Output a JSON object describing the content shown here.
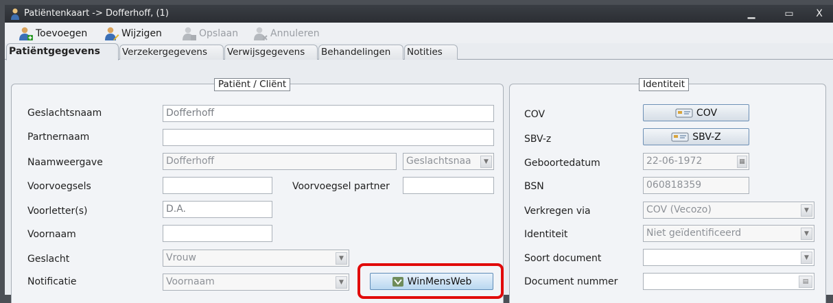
{
  "window": {
    "title": "Patiëntenkaart -> Dofferhoff, (1)",
    "controls": {
      "minimize": "▁",
      "maximize": "▭",
      "close": "X"
    }
  },
  "toolbar": {
    "add_label": "Toevoegen",
    "edit_label": "Wijzigen",
    "save_label": "Opslaan",
    "cancel_label": "Annuleren"
  },
  "tabs": [
    {
      "label": "Patiëntgegevens",
      "active": true
    },
    {
      "label": "Verzekergegevens"
    },
    {
      "label": "Verwijsgegevens"
    },
    {
      "label": "Behandelingen"
    },
    {
      "label": "Notities"
    }
  ],
  "patient": {
    "legend": "Patiënt / Cliënt",
    "geslachtsnaam": {
      "label": "Geslachtsnaam",
      "value": "Dofferhoff"
    },
    "partnernaam": {
      "label": "Partnernaam",
      "value": ""
    },
    "naamweergave": {
      "label": "Naamweergave",
      "value": "Dofferhoff",
      "option": "Geslachtsnaa"
    },
    "voorvoegsels": {
      "label": "Voorvoegsels",
      "value": ""
    },
    "voorvoegsel_partner": {
      "label": "Voorvoegsel partner",
      "value": ""
    },
    "voorletters": {
      "label": "Voorletter(s)",
      "value": "D.A."
    },
    "voornaam": {
      "label": "Voornaam",
      "value": ""
    },
    "geslacht": {
      "label": "Geslacht",
      "value": "Vrouw"
    },
    "notificatie": {
      "label": "Notificatie",
      "value": "Voornaam"
    },
    "winmensweb_label": "WinMensWeb"
  },
  "identiteit": {
    "legend": "Identiteit",
    "cov": {
      "label": "COV",
      "button": "COV"
    },
    "sbvz": {
      "label": "SBV-z",
      "button": "SBV-Z"
    },
    "geboortedatum": {
      "label": "Geboortedatum",
      "value": "22-06-1972"
    },
    "bsn": {
      "label": "BSN",
      "value": "060818359"
    },
    "verkregen_via": {
      "label": "Verkregen via",
      "value": "COV (Vecozo)"
    },
    "identiteit": {
      "label": "Identiteit",
      "value": "Niet geïdentificeerd"
    },
    "soort_document": {
      "label": "Soort document",
      "value": ""
    },
    "document_nummer": {
      "label": "Document nummer",
      "value": ""
    }
  },
  "colors": {
    "highlight": "#e10a0a",
    "titlebar": "#2f3237",
    "panel": "#f2f4f7"
  }
}
